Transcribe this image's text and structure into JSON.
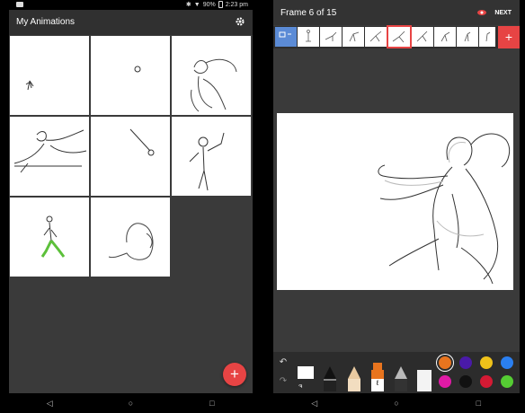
{
  "left": {
    "status": {
      "time": "2:23 pm",
      "battery": "90%"
    },
    "title": "My Animations",
    "settings_icon": "gear-icon",
    "fab_label": "+",
    "nav": [
      "◁",
      "○",
      "□"
    ]
  },
  "right": {
    "title": "Frame 6 of 15",
    "next_label": "NEXT",
    "onion_icon": "eye-icon",
    "add_frame_label": "+",
    "undo_icon": "undo-icon",
    "redo_icon": "redo-icon",
    "colors": [
      "#e8741e",
      "#4a1aa8",
      "#f0c21a",
      "#2a7ff0",
      "#e01aa6",
      "#111111",
      "#d41a34",
      "#55cc33"
    ],
    "nav": [
      "◁",
      "○",
      "□"
    ]
  },
  "colors": {
    "accent": "#e74444",
    "panel": "#3a3a3a",
    "appbar": "#303030"
  }
}
